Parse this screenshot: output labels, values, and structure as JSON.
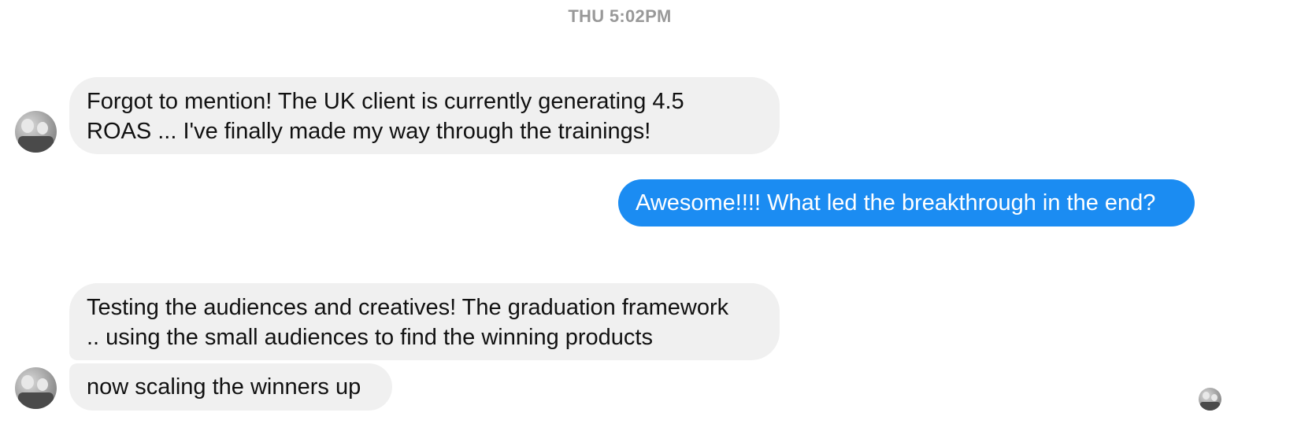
{
  "timestamp": "THU 5:02PM",
  "messages": [
    {
      "direction": "incoming",
      "lines": [
        "Forgot to mention! The UK client is currently generating 4.5",
        "ROAS ... I've finally made my way through the trainings!"
      ]
    },
    {
      "direction": "outgoing",
      "lines": [
        "Awesome!!!! What led the breakthrough in the end?"
      ]
    },
    {
      "direction": "incoming",
      "lines": [
        "Testing the audiences and creatives! The graduation framework",
        ".. using the small audiences to find the winning products"
      ]
    },
    {
      "direction": "incoming",
      "lines": [
        "now scaling the winners up"
      ]
    }
  ],
  "colors": {
    "incoming_bubble": "#f0f0f0",
    "outgoing_bubble": "#1b8cf2",
    "timestamp_text": "#999999"
  },
  "icons": {
    "sender_avatar": "avatar-photo",
    "read_receipt": "read-receipt-avatar"
  }
}
